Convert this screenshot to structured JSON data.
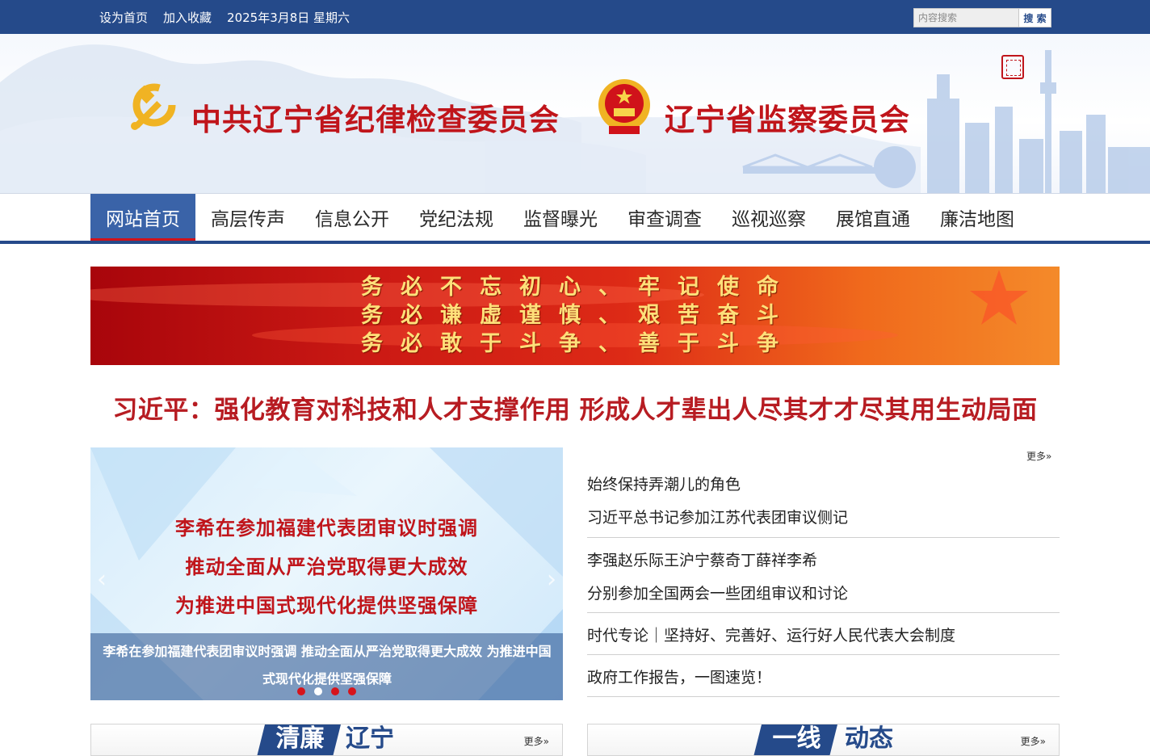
{
  "topbar": {
    "set_home": "设为首页",
    "add_favorite": "加入收藏",
    "date": "2025年3月8日 星期六",
    "search_placeholder": "内容搜索",
    "search_button": "搜 索"
  },
  "header": {
    "party_title": "中共辽宁省纪律检查委员会",
    "state_title": "辽宁省监察委员会"
  },
  "nav": {
    "items": [
      "网站首页",
      "高层传声",
      "信息公开",
      "党纪法规",
      "监督曝光",
      "审查调查",
      "巡视巡察",
      "展馆直通",
      "廉洁地图"
    ]
  },
  "slogan": {
    "lines": [
      "务必不忘初心、牢记使命",
      "务必谦虚谨慎、艰苦奋斗",
      "务必敢于斗争、善于斗争"
    ]
  },
  "headline": "习近平：强化教育对科技和人才支撑作用 形成人才辈出人尽其才才尽其用生动局面",
  "carousel": {
    "slide_lines": [
      "李希在参加福建代表团审议时强调",
      "推动全面从严治党取得更大成效",
      "为推进中国式现代化提供坚强保障"
    ],
    "caption": "李希在参加福建代表团审议时强调 推动全面从严治党取得更大成效 为推进中国式现代化提供坚强保障",
    "prev": "‹",
    "next": "›",
    "active_dot": 2,
    "dot_count": 4
  },
  "news": {
    "more": "更多»",
    "items": [
      "始终保持弄潮儿的角色",
      "习近平总书记参加江苏代表团审议侧记",
      "李强赵乐际王沪宁蔡奇丁薛祥李希",
      "分别参加全国两会一些团组审议和讨论",
      "时代专论｜坚持好、完善好、运行好人民代表大会制度",
      "政府工作报告，一图速览！"
    ]
  },
  "sections": {
    "left": {
      "tag": "清廉",
      "rest": "辽宁",
      "more": "更多»"
    },
    "right": {
      "tag": "一线",
      "rest": "动态",
      "more": "更多»"
    }
  },
  "colors": {
    "brand_blue": "#254a8a",
    "party_red": "#c0151b",
    "headline_red": "#b71c22"
  }
}
